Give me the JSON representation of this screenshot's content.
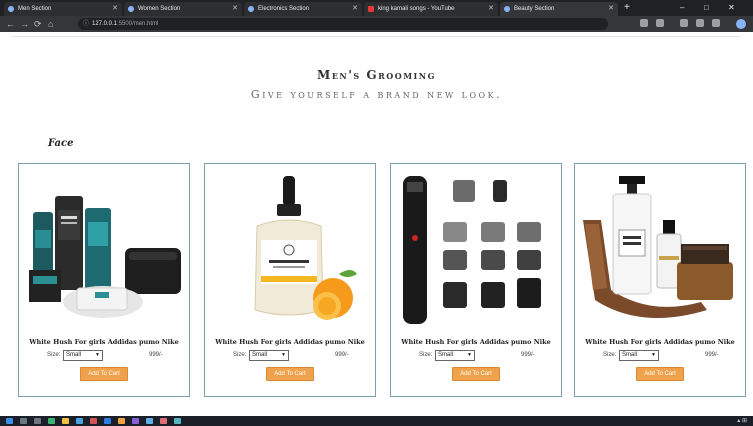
{
  "browser": {
    "tabs": [
      {
        "label": "Men Section",
        "active": false
      },
      {
        "label": "Women Section",
        "active": false
      },
      {
        "label": "Electronics Section",
        "active": false
      },
      {
        "label": "king kamali songs - YouTube",
        "active": false
      },
      {
        "label": "Beauty Section",
        "active": true
      }
    ],
    "new_tab": "+",
    "window_controls": [
      "–",
      "□",
      "✕"
    ],
    "address": {
      "host": "127.0.0.1",
      "path": ":5500/men.html"
    }
  },
  "page": {
    "title": "Men's Grooming",
    "subtitle": "Give yourself a brand new look.",
    "section": "Face",
    "products": [
      {
        "name": "White Hush For girls Addidas pumo Nike",
        "size_label": "Size:",
        "size_value": "Small",
        "price": "999/-",
        "button": "Add To Cart",
        "image": "grooming-kit"
      },
      {
        "name": "White Hush For girls Addidas pumo Nike",
        "size_label": "Size:",
        "size_value": "Small",
        "price": "999/-",
        "button": "Add To Cart",
        "image": "face-serum"
      },
      {
        "name": "White Hush For girls Addidas pumo Nike",
        "size_label": "Size:",
        "size_value": "Small",
        "price": "999/-",
        "button": "Add To Cart",
        "image": "trimmer-set"
      },
      {
        "name": "White Hush For girls Addidas pumo Nike",
        "size_label": "Size:",
        "size_value": "Small",
        "price": "999/-",
        "button": "Add To Cart",
        "image": "beard-kit"
      }
    ]
  },
  "colors": {
    "card_border": "#7a9fb0",
    "button": "#f0a14b",
    "chrome_dark": "#202124"
  }
}
